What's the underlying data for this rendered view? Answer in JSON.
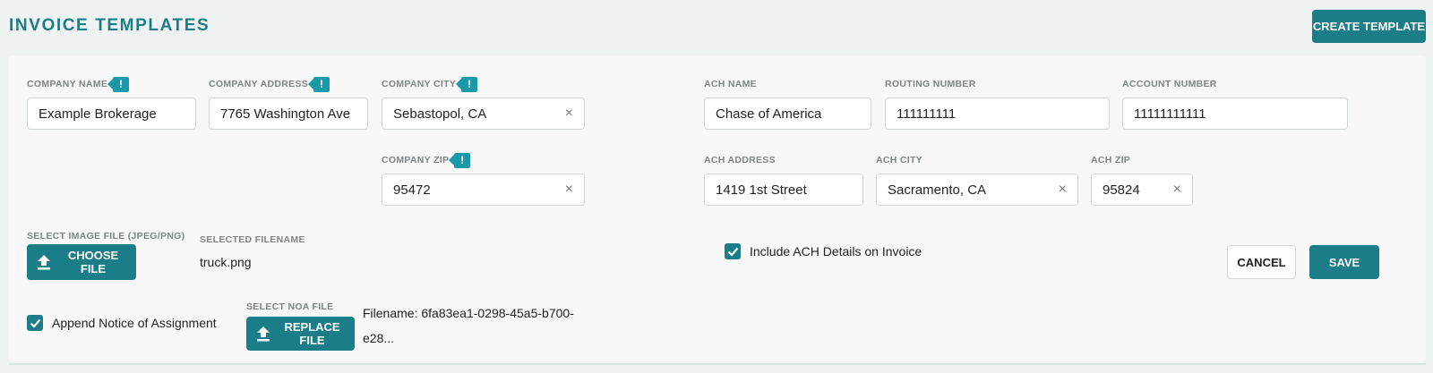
{
  "page": {
    "title": "INVOICE TEMPLATES",
    "create_label": "CREATE TEMPLATE"
  },
  "company": {
    "name_label": "COMPANY NAME",
    "name_value": "Example Brokerage",
    "address_label": "COMPANY ADDRESS",
    "address_value": "7765 Washington Ave",
    "city_label": "COMPANY CITY",
    "city_value": "Sebastopol, CA",
    "zip_label": "COMPANY ZIP",
    "zip_value": "95472",
    "flag_glyph": "!"
  },
  "ach": {
    "name_label": "ACH NAME",
    "name_value": "Chase of America",
    "routing_label": "ROUTING NUMBER",
    "routing_value": "111111111",
    "account_label": "ACCOUNT NUMBER",
    "account_value": "11111111111",
    "address_label": "ACH ADDRESS",
    "address_value": "1419 1st Street",
    "city_label": "ACH CITY",
    "city_value": "Sacramento, CA",
    "zip_label": "ACH ZIP",
    "zip_value": "95824",
    "include_label": "Include ACH Details on Invoice",
    "include_checked": true
  },
  "image": {
    "select_label": "SELECT IMAGE FILE (JPEG/PNG)",
    "choose_label": "CHOOSE FILE",
    "selected_label": "SELECTED FILENAME",
    "selected_value": "truck.png"
  },
  "noa": {
    "append_label": "Append Notice of Assignment",
    "append_checked": true,
    "select_label": "SELECT NOA FILE",
    "replace_label": "REPLACE FILE",
    "filename_line1": "Filename: 6fa83ea1-0298-45a5-b700-",
    "filename_line2": "e28..."
  },
  "actions": {
    "cancel_label": "CANCEL",
    "save_label": "SAVE"
  },
  "colors": {
    "accent": "#1a7d87",
    "title": "#1b7d86",
    "flag": "#1a9aa8",
    "background": "#eff2f2",
    "card": "#f8f8f8"
  },
  "icons": {
    "clear": "×",
    "upload": "upload-icon",
    "check": "checkmark-icon",
    "flag": "exclamation-flag-icon"
  }
}
